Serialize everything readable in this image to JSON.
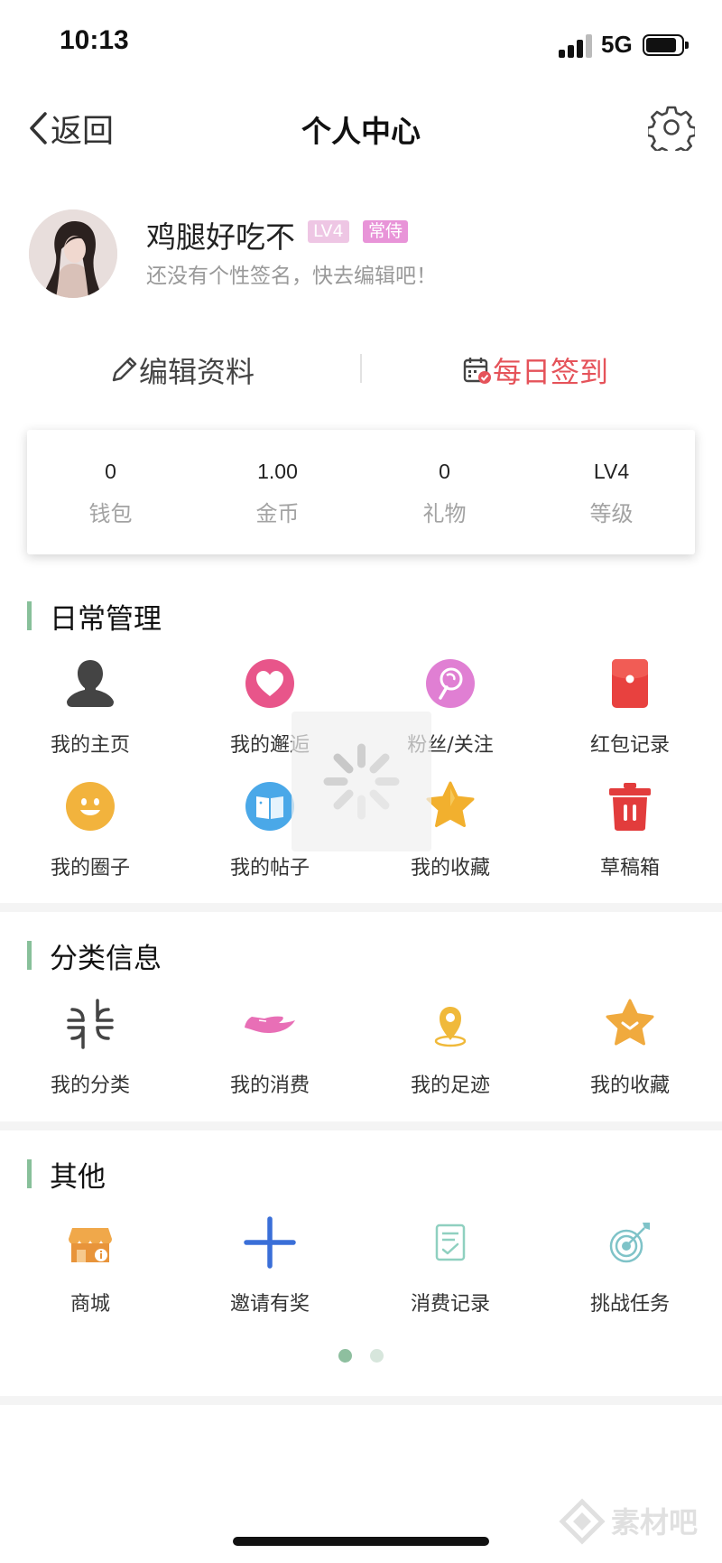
{
  "status_bar": {
    "time": "10:13",
    "network": "5G"
  },
  "nav": {
    "back_label": "返回",
    "title": "个人中心"
  },
  "profile": {
    "name": "鸡腿好吃不",
    "level_badge": "LV4",
    "title_badge": "常侍",
    "signature": "还没有个性签名，快去编辑吧！"
  },
  "actions": {
    "edit_label": "编辑资料",
    "checkin_label": "每日签到"
  },
  "stats": [
    {
      "value": "0",
      "label": "钱包"
    },
    {
      "value": "1.00",
      "label": "金币"
    },
    {
      "value": "0",
      "label": "礼物"
    },
    {
      "value": "LV4",
      "label": "等级"
    }
  ],
  "daily": {
    "title": "日常管理",
    "items": [
      {
        "label": "我的主页",
        "icon": "person-icon"
      },
      {
        "label": "我的邂逅",
        "icon": "heart-icon"
      },
      {
        "label": "粉丝/关注",
        "icon": "lollipop-icon"
      },
      {
        "label": "红包记录",
        "icon": "red-envelope-icon"
      },
      {
        "label": "我的圈子",
        "icon": "smiley-icon"
      },
      {
        "label": "我的帖子",
        "icon": "book-icon"
      },
      {
        "label": "我的收藏",
        "icon": "star-icon"
      },
      {
        "label": "草稿箱",
        "icon": "trash-icon"
      }
    ]
  },
  "category": {
    "title": "分类信息",
    "items": [
      {
        "label": "我的分类",
        "icon": "category-icon"
      },
      {
        "label": "我的消费",
        "icon": "hand-icon"
      },
      {
        "label": "我的足迹",
        "icon": "location-pin-icon"
      },
      {
        "label": "我的收藏",
        "icon": "star-badge-icon"
      }
    ]
  },
  "other": {
    "title": "其他",
    "items": [
      {
        "label": "商城",
        "icon": "shop-icon"
      },
      {
        "label": "邀请有奖",
        "icon": "plus-icon"
      },
      {
        "label": "消费记录",
        "icon": "checklist-icon"
      },
      {
        "label": "挑战任务",
        "icon": "target-icon"
      }
    ]
  },
  "colors": {
    "accent_green": "#88c09a",
    "checkin_red": "#e5535a",
    "badge_pink": "#e894d8"
  },
  "watermark": {
    "text": "素材吧"
  }
}
